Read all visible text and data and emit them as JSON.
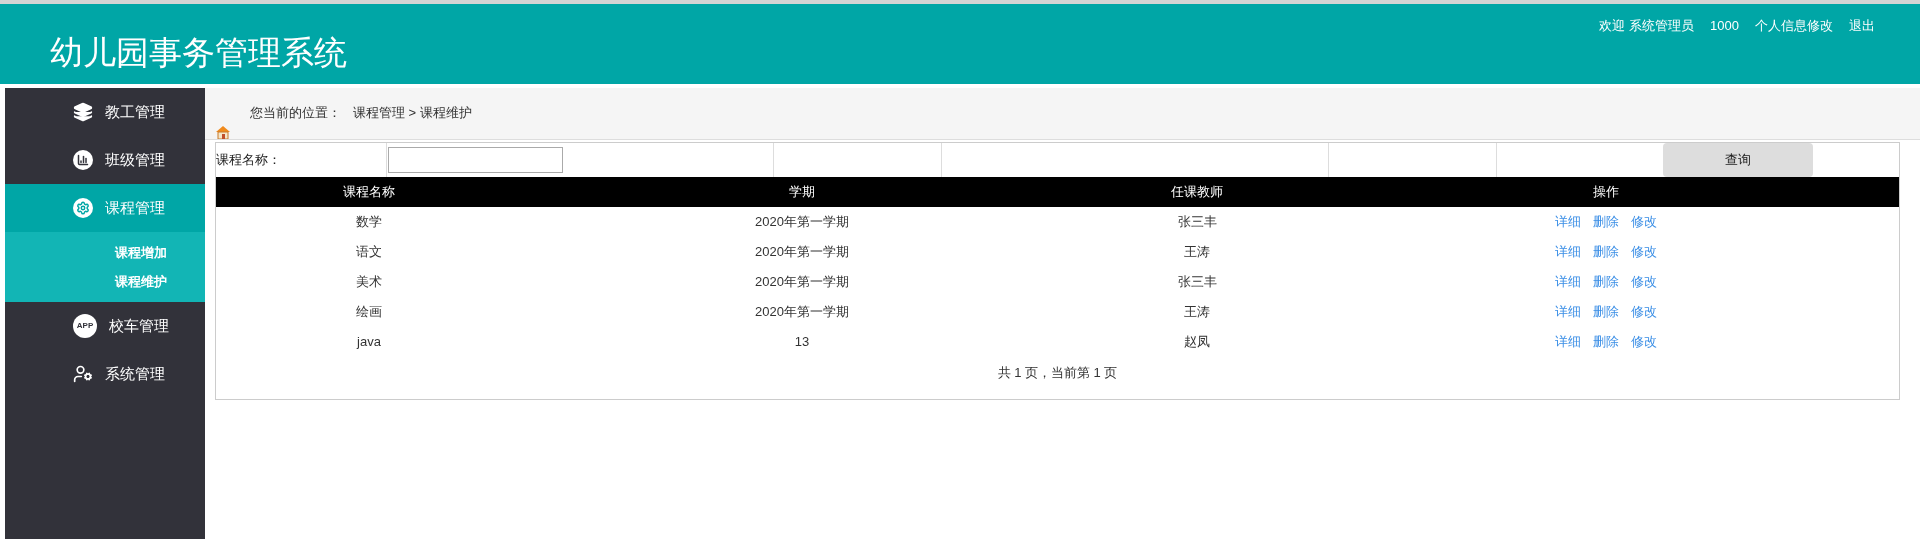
{
  "header": {
    "title": "幼儿园事务管理系统",
    "user_menu": [
      "欢迎 系统管理员",
      "1000",
      "个人信息修改",
      "退出"
    ]
  },
  "sidebar": {
    "items": [
      {
        "label": "教工管理",
        "selected": false
      },
      {
        "label": "班级管理",
        "selected": false
      },
      {
        "label": "课程管理",
        "selected": true,
        "children": [
          {
            "label": "课程增加"
          },
          {
            "label": "课程维护"
          }
        ]
      },
      {
        "icon_text": "APP",
        "label": "校车管理",
        "selected": false
      },
      {
        "label": "系统管理",
        "selected": false
      }
    ]
  },
  "breadcrumb": {
    "prefix": "您当前的位置：",
    "path": [
      "课程管理",
      ">",
      "课程维护"
    ]
  },
  "search": {
    "label": "课程名称：",
    "button": "查询"
  },
  "table": {
    "columns": [
      "课程名称",
      "学期",
      "任课教师",
      "操作"
    ],
    "rows": [
      {
        "cells": [
          "数学",
          "2020年第一学期",
          "张三丰"
        ],
        "actions": [
          "详细",
          "删除",
          "修改"
        ]
      },
      {
        "cells": [
          "语文",
          "2020年第一学期",
          "王涛"
        ],
        "actions": [
          "详细",
          "删除",
          "修改"
        ]
      },
      {
        "cells": [
          "美术",
          "2020年第一学期",
          "张三丰"
        ],
        "actions": [
          "详细",
          "删除",
          "修改"
        ]
      },
      {
        "cells": [
          "绘画",
          "2020年第一学期",
          "王涛"
        ],
        "actions": [
          "详细",
          "删除",
          "修改"
        ]
      },
      {
        "cells": [
          "java",
          "13",
          "赵凤"
        ],
        "actions": [
          "详细",
          "删除",
          "修改"
        ]
      }
    ],
    "pager": "共 1 页，当前第 1 页"
  }
}
